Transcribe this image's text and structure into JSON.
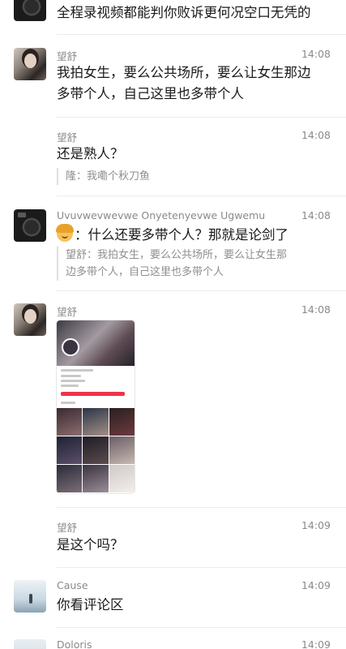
{
  "messages": [
    {
      "name": "",
      "time": "",
      "text": "全程录视频都能判你败诉更何况空口无凭的"
    },
    {
      "name": "望舒",
      "time": "14:08",
      "text_lines": [
        "我拍女生，要么公共场所，要么让女生那边",
        "多带个人，自己这里也多带个人"
      ]
    },
    {
      "name": "望舒",
      "time": "14:08",
      "text": "还是熟人？",
      "quote": "隆：我嘞个秋刀鱼"
    },
    {
      "name": "Uvuvwevwevwe Onyetenyevwe Ugwemu",
      "time": "14:08",
      "text": "：什么还要多带个人？那就是论剑了",
      "emoji": "woman-face-emoji",
      "quote_lines": [
        "望舒：我拍女生，要么公共场所，要么让女生那",
        "边多带个人，自己这里也多带个人"
      ]
    },
    {
      "name": "望舒",
      "time": "14:08",
      "image": "profile-screenshot-image"
    },
    {
      "name": "望舒",
      "time": "14:09",
      "text": "是这个吗？"
    },
    {
      "name": "Cause",
      "time": "14:09",
      "text": "你看评论区"
    },
    {
      "name": "Doloris",
      "time": "14:09"
    }
  ]
}
